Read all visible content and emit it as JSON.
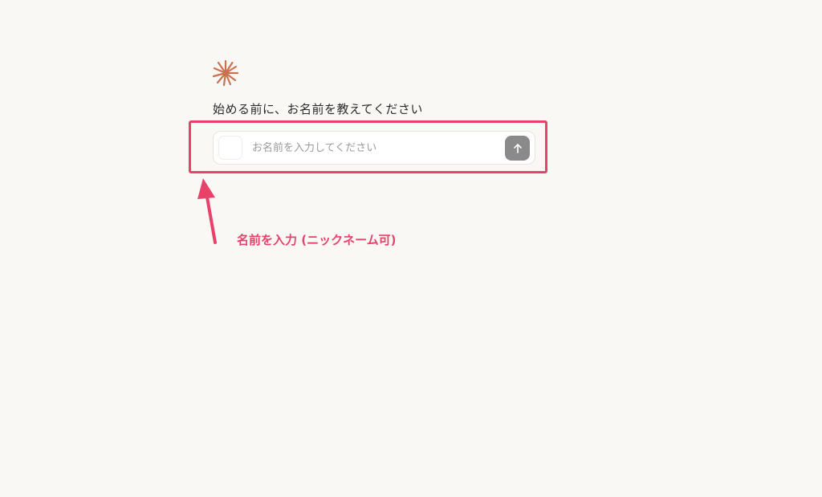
{
  "header": {
    "logo_icon": "asterisk-burst-icon",
    "logo_color": "#c8734f",
    "prompt": "始める前に、お名前を教えてください"
  },
  "name_input": {
    "placeholder": "お名前を入力してください",
    "value": ""
  },
  "send_button": {
    "icon": "arrow-up-icon"
  },
  "annotation": {
    "label": "名前を入力 (ニックネーム可)",
    "color": "#e8426b"
  }
}
